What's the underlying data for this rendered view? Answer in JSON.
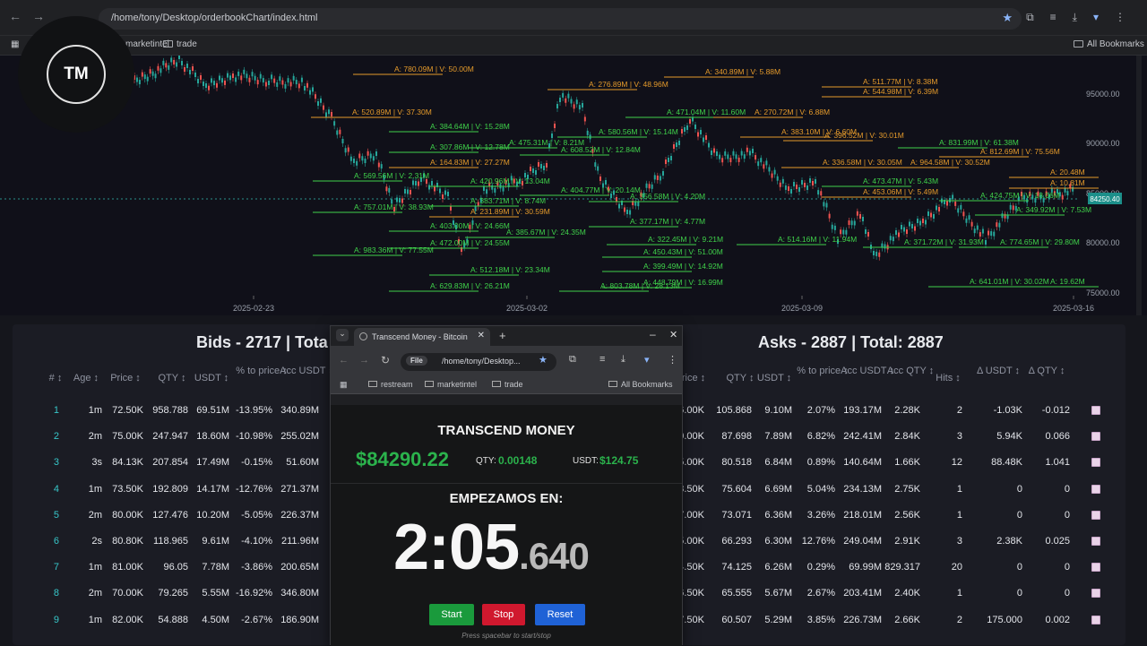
{
  "browser": {
    "url": "/home/tony/Desktop/orderbookChart/index.html",
    "bookmarks": [
      "marketintel",
      "trade"
    ],
    "all_bookmarks": "All Bookmarks"
  },
  "logo": {
    "text": "TM"
  },
  "chart": {
    "x_ticks": [
      "2025-02-23",
      "2025-03-02",
      "2025-03-09",
      "2025-03-16"
    ],
    "y_ticks": [
      "95000.00",
      "90000.00",
      "85000.00",
      "80000.00",
      "75000.00"
    ],
    "price_tag": "84250.40",
    "labels": [
      {
        "t": "A: 780.09M | V: 50.00M",
        "c": "o"
      },
      {
        "t": "A: 520.89M | V: 37.30M",
        "c": "o"
      },
      {
        "t": "A: 384.64M | V: 15.28M",
        "c": "g"
      },
      {
        "t": "A: 307.86M | V: 12.78M",
        "c": "g"
      },
      {
        "t": "A: 164.83M | V: 27.27M",
        "c": "o"
      },
      {
        "t": "A: 475.31M | V: 8.21M",
        "c": "g"
      },
      {
        "t": "A: 420.96M | V: 13.04M",
        "c": "g"
      },
      {
        "t": "A: 383.71M | V: 8.74M",
        "c": "g"
      },
      {
        "t": "A: 231.89M | V: 30.59M",
        "c": "o"
      },
      {
        "t": "A: 385.67M | V: 24.35M",
        "c": "g"
      },
      {
        "t": "A: 403.00M | V: 24.66M",
        "c": "g"
      },
      {
        "t": "A: 472.00M | V: 24.55M",
        "c": "g"
      },
      {
        "t": "A: 569.56M | V: 2.31M",
        "c": "g"
      },
      {
        "t": "A: 757.01M | V: 38.93M",
        "c": "g"
      },
      {
        "t": "A: 983.36M | V: 77.55M",
        "c": "g"
      },
      {
        "t": "A: 512.18M | V: 23.34M",
        "c": "g"
      },
      {
        "t": "A: 629.83M | V: 26.21M",
        "c": "g"
      },
      {
        "t": "A: 276.89M | V: 48.96M",
        "c": "o"
      },
      {
        "t": "A: 340.89M | V: 5.88M",
        "c": "o"
      },
      {
        "t": "A: 471.04M | V: 11.60M",
        "c": "g"
      },
      {
        "t": "A: 270.72M | V: 6.88M",
        "c": "o"
      },
      {
        "t": "A: 580.56M | V: 15.14M",
        "c": "g"
      },
      {
        "t": "A: 608.52M | V: 12.84M",
        "c": "g"
      },
      {
        "t": "A: 383.10M | V: 6.60M",
        "c": "o"
      },
      {
        "t": "A: 396.52M | V: 30.01M",
        "c": "o"
      },
      {
        "t": "A: 336.58M | V: 30.05M",
        "c": "o"
      },
      {
        "t": "A: 964.58M | V: 30.52M",
        "c": "o"
      },
      {
        "t": "A: 831.99M | V: 61.38M",
        "c": "g"
      },
      {
        "t": "A: 812.69M | V: 75.56M",
        "c": "o"
      },
      {
        "t": "A: 404.77M | V: 20.14M",
        "c": "g"
      },
      {
        "t": "A: 356.58M | V: 4.20M",
        "c": "g"
      },
      {
        "t": "A: 377.17M | V: 4.77M",
        "c": "g"
      },
      {
        "t": "A: 514.16M | V: 11.94M",
        "c": "g"
      },
      {
        "t": "A: 322.45M | V: 9.21M",
        "c": "g"
      },
      {
        "t": "A: 450.43M | V: 51.00M",
        "c": "g"
      },
      {
        "t": "A: 399.49M | V: 14.92M",
        "c": "g"
      },
      {
        "t": "A: 448.79M | V: 16.99M",
        "c": "g"
      },
      {
        "t": "A: 803.78M | V: 28.13M",
        "c": "g"
      },
      {
        "t": "A: 424.75M | V: 18.06M",
        "c": "g"
      },
      {
        "t": "A: 349.92M | V: 7.53M",
        "c": "g"
      },
      {
        "t": "A: 774.65M | V: 29.80M",
        "c": "g"
      },
      {
        "t": "A: 641.01M | V: 30.02M",
        "c": "g"
      },
      {
        "t": "A: 544.98M | V: 6.39M",
        "c": "o"
      },
      {
        "t": "A: 511.77M | V: 8.38M",
        "c": "o"
      },
      {
        "t": "A: 473.47M | V: 5.43M",
        "c": "g"
      },
      {
        "t": "A: 453.06M | V: 5.49M",
        "c": "o"
      },
      {
        "t": "A: 371.72M | V: 31.93M",
        "c": "g"
      },
      {
        "t": "A: 20.48M",
        "c": "o"
      },
      {
        "t": "A: 10.81M",
        "c": "o"
      },
      {
        "t": "A: 19.62M",
        "c": "g"
      }
    ]
  },
  "bids": {
    "title": "Bids - 2717 | Tota",
    "headers": [
      "#",
      "Age",
      "Price",
      "QTY",
      "USDT",
      "% to price",
      "Acc USDT"
    ],
    "rows": [
      [
        "1",
        "1m",
        "72.50K",
        "958.788",
        "69.51M",
        "-13.95%",
        "340.89M"
      ],
      [
        "2",
        "2m",
        "75.00K",
        "247.947",
        "18.60M",
        "-10.98%",
        "255.02M"
      ],
      [
        "3",
        "3s",
        "84.13K",
        "207.854",
        "17.49M",
        "-0.15%",
        "51.60M"
      ],
      [
        "4",
        "1m",
        "73.50K",
        "192.809",
        "14.17M",
        "-12.76%",
        "271.37M"
      ],
      [
        "5",
        "2m",
        "80.00K",
        "127.476",
        "10.20M",
        "-5.05%",
        "226.37M"
      ],
      [
        "6",
        "2s",
        "80.80K",
        "118.965",
        "9.61M",
        "-4.10%",
        "211.96M"
      ],
      [
        "7",
        "1m",
        "81.00K",
        "96.05",
        "7.78M",
        "-3.86%",
        "200.65M"
      ],
      [
        "8",
        "2m",
        "70.00K",
        "79.265",
        "5.55M",
        "-16.92%",
        "346.80M"
      ],
      [
        "9",
        "1m",
        "82.00K",
        "54.888",
        "4.50M",
        "-2.67%",
        "186.90M"
      ]
    ]
  },
  "asks": {
    "title": "Asks - 2887 | Total: 2887",
    "headers": [
      "rice",
      "QTY",
      "USDT",
      "% to price",
      "Acc USDT",
      "Acc QTY",
      "Hits",
      "Δ USDT",
      "Δ QTY"
    ],
    "rows": [
      [
        "6.00K",
        "105.868",
        "9.10M",
        "2.07%",
        "193.17M",
        "2.28K",
        "2",
        "-1.03K",
        "-0.012"
      ],
      [
        "0.00K",
        "87.698",
        "7.89M",
        "6.82%",
        "242.41M",
        "2.84K",
        "3",
        "5.94K",
        "0.066"
      ],
      [
        "5.00K",
        "80.518",
        "6.84M",
        "0.89%",
        "140.64M",
        "1.66K",
        "12",
        "88.48K",
        "1.041"
      ],
      [
        "8.50K",
        "75.604",
        "6.69M",
        "5.04%",
        "234.13M",
        "2.75K",
        "1",
        "0",
        "0"
      ],
      [
        "7.00K",
        "73.071",
        "6.36M",
        "3.26%",
        "218.01M",
        "2.56K",
        "1",
        "0",
        "0"
      ],
      [
        "5.00K",
        "66.293",
        "6.30M",
        "12.76%",
        "249.04M",
        "2.91K",
        "3",
        "2.38K",
        "0.025"
      ],
      [
        "4.50K",
        "74.125",
        "6.26M",
        "0.29%",
        "69.99M",
        "829.317",
        "20",
        "0",
        "0"
      ],
      [
        "6.50K",
        "65.555",
        "5.67M",
        "2.67%",
        "203.41M",
        "2.40K",
        "1",
        "0",
        "0"
      ],
      [
        "7.50K",
        "60.507",
        "5.29M",
        "3.85%",
        "226.73M",
        "2.66K",
        "2",
        "175.000",
        "0.002"
      ]
    ]
  },
  "popup": {
    "tab_title": "Transcend Money - Bitcoin",
    "file_label": "File",
    "url": "/home/tony/Desktop...",
    "bookmarks": [
      "restream",
      "marketintel",
      "trade"
    ],
    "all_bookmarks": "All Bookmarks",
    "brand": "TRANSCEND MONEY",
    "price": "$84290.22",
    "qty_label": "QTY:",
    "qty_value": "0.00148",
    "usdt_label": "USDT:",
    "usdt_value": "$124.75",
    "countdown_label": "EMPEZAMOS EN:",
    "timer_main": "2:05",
    "timer_ms": ".640",
    "start": "Start",
    "stop": "Stop",
    "reset": "Reset",
    "hint": "Press spacebar to start/stop"
  }
}
